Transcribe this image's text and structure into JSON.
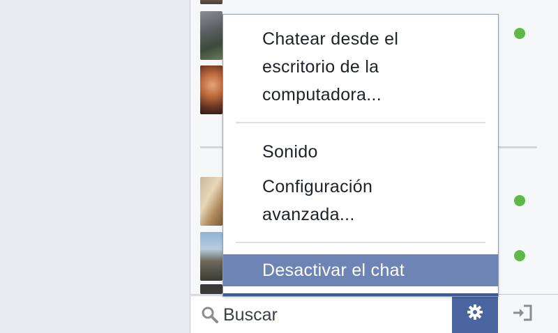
{
  "chat_menu": {
    "items": [
      {
        "label": "Chatear desde el\nescritorio de la\ncomputadora..."
      },
      {
        "label": "Sonido"
      },
      {
        "label": "Configuración\navanzada..."
      },
      {
        "label": "Desactivar el chat",
        "highlighted": true
      }
    ]
  },
  "search": {
    "placeholder": "Buscar"
  },
  "icons": {
    "search": "search-icon",
    "settings": "gear-icon",
    "popout": "popout-icon"
  },
  "colors": {
    "online": "#5fb946",
    "menu_highlight": "#6d84b4",
    "gear_button": "#4a65a0",
    "sidebar_bg": "#f6f7f9"
  }
}
